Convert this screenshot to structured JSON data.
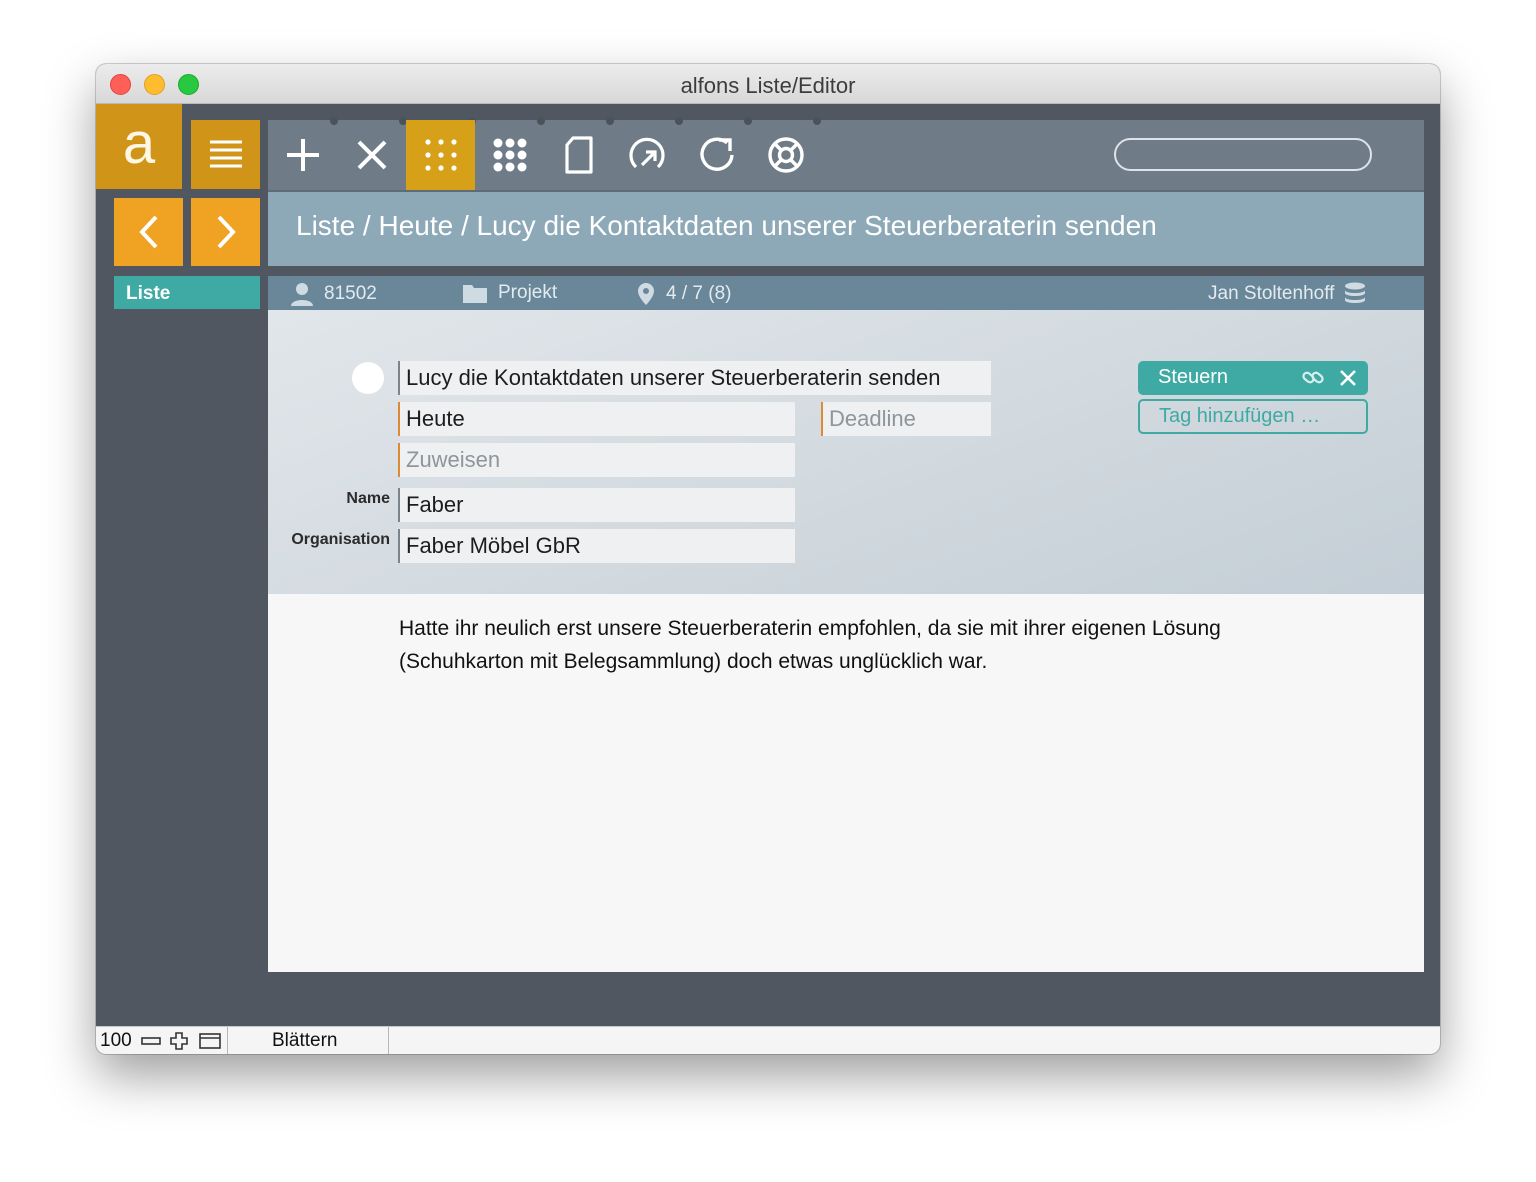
{
  "window": {
    "title": "alfons Liste/Editor"
  },
  "logo": {
    "letter": "a"
  },
  "sidebar": {
    "list_label": "Liste"
  },
  "toolbar": {
    "tools": [
      {
        "name": "plus-icon",
        "active": false
      },
      {
        "name": "close-icon",
        "active": false
      },
      {
        "name": "dots-grid-small-icon",
        "active": true
      },
      {
        "name": "dots-grid-icon",
        "active": false
      },
      {
        "name": "document-icon",
        "active": false
      },
      {
        "name": "spiral-arrow-icon",
        "active": false
      },
      {
        "name": "refresh-icon",
        "active": false
      },
      {
        "name": "lifebuoy-icon",
        "active": false
      }
    ],
    "search_value": ""
  },
  "header": {
    "breadcrumb": "Liste / Heute / Lucy die Kontaktdaten unserer Steuerberaterin senden"
  },
  "info": {
    "id": "81502",
    "project": "Projekt",
    "position": "4 / 7 (8)",
    "user": "Jan Stoltenhoff"
  },
  "form": {
    "title": "Lucy die Kontaktdaten unserer Steuerberaterin senden",
    "list": "Heute",
    "deadline_placeholder": "Deadline",
    "assign_placeholder": "Zuweisen",
    "name_label": "Name",
    "name": "Faber",
    "org_label": "Organisation",
    "organisation": "Faber Möbel GbR"
  },
  "tags": {
    "items": [
      "Steuern"
    ],
    "add_label": "Tag hinzufügen …"
  },
  "notes": {
    "text": "Hatte ihr neulich erst unsere Steuerberaterin empfohlen, da sie mit ihrer eigenen Lösung (Schuhkarton mit Belegsammlung) doch etwas unglücklich war."
  },
  "statusbar": {
    "zoom": "100",
    "mode": "Blättern"
  },
  "colors": {
    "accent_orange": "#f0a322",
    "accent_dark_orange": "#d09518",
    "teal": "#3eaaa3",
    "toolbar": "#6f7c87",
    "header": "#8da9b8",
    "background": "#515760"
  }
}
